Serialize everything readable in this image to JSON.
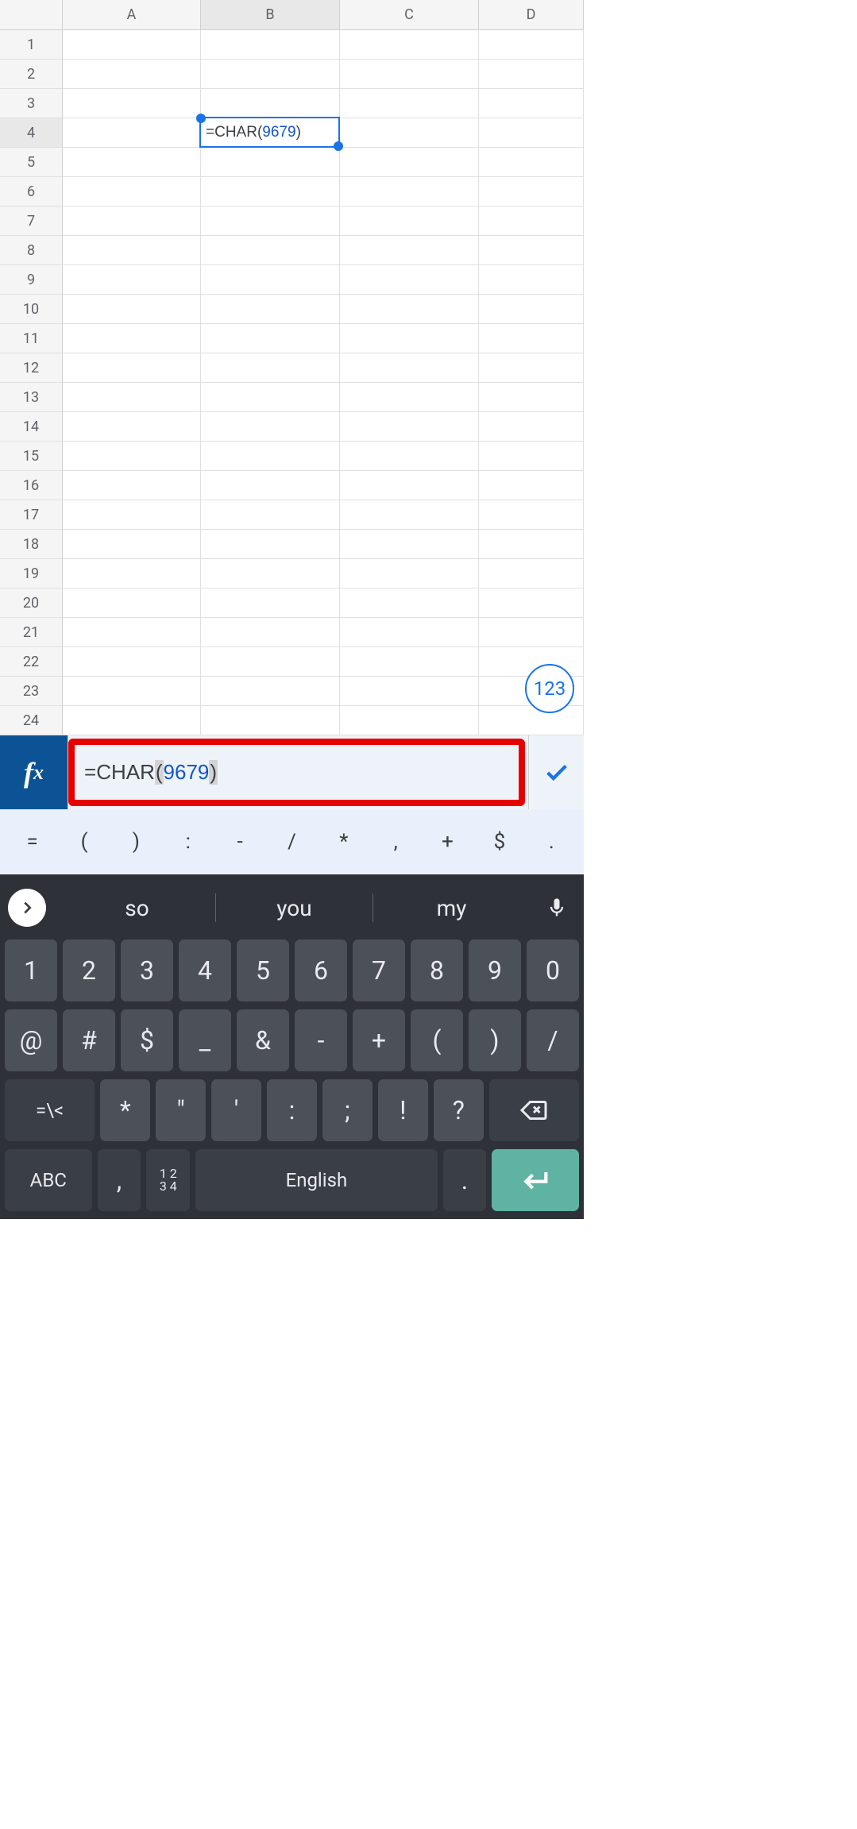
{
  "columns": [
    "A",
    "B",
    "C",
    "D"
  ],
  "rows": [
    1,
    2,
    3,
    4,
    5,
    6,
    7,
    8,
    9,
    10,
    11,
    12,
    13,
    14,
    15,
    16,
    17,
    18,
    19,
    20,
    21,
    22,
    23,
    24
  ],
  "selected_col": "B",
  "selected_row": 4,
  "active_cell": {
    "ref": "B4",
    "formula_parts": {
      "eq": "=",
      "fn": "CHAR",
      "open": "(",
      "arg": "9679",
      "close": ")"
    }
  },
  "float_button": "123",
  "formula_bar": {
    "fx": "fx",
    "parts": {
      "eq": "=",
      "fn": "CHAR",
      "open": "(",
      "arg": "9679",
      "close": ")"
    }
  },
  "symbol_row": [
    "=",
    "(",
    ")",
    ":",
    "-",
    "/",
    "*",
    ",",
    "+",
    "$",
    "."
  ],
  "keyboard": {
    "suggestions": [
      "so",
      "you",
      "my"
    ],
    "rows": [
      [
        "1",
        "2",
        "3",
        "4",
        "5",
        "6",
        "7",
        "8",
        "9",
        "0"
      ],
      [
        "@",
        "#",
        "$",
        "_",
        "&",
        "-",
        "+",
        "(",
        ")",
        "/"
      ],
      [
        "=\\<",
        "*",
        "\"",
        "'",
        ":",
        ";",
        "!",
        "?",
        "⌫"
      ],
      [
        "ABC",
        ",",
        "1234",
        "English",
        ".",
        "↵"
      ]
    ],
    "numgrid": {
      "top": "1 2",
      "bot": "3 4"
    }
  }
}
